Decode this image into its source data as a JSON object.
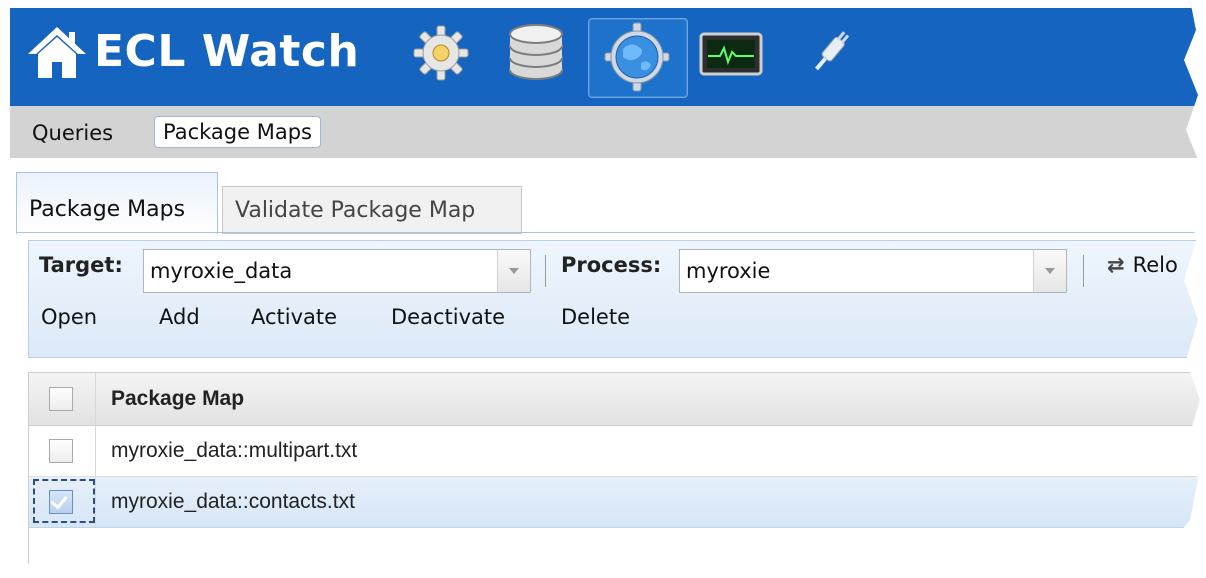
{
  "app": {
    "title": "ECL Watch",
    "icons": [
      "home-icon",
      "gear-icon",
      "database-icon",
      "topology-globe-icon",
      "monitor-icon",
      "plug-icon"
    ],
    "selected_icon": "topology-globe-icon",
    "brand_color": "#1565c0"
  },
  "subnav": {
    "items": [
      {
        "label": "Queries",
        "active": false
      },
      {
        "label": "Package Maps",
        "active": true
      }
    ]
  },
  "tabs": [
    {
      "label": "Package Maps",
      "active": true
    },
    {
      "label": "Validate Package Map",
      "active": false
    }
  ],
  "toolbar": {
    "target_label": "Target:",
    "target_value": "myroxie_data",
    "process_label": "Process:",
    "process_value": "myroxie",
    "reload_label": "Relo",
    "actions": [
      "Open",
      "Add",
      "Activate",
      "Deactivate",
      "Delete"
    ]
  },
  "grid": {
    "column_header": "Package Map",
    "rows": [
      {
        "name": "myroxie_data::multipart.txt",
        "checked": false
      },
      {
        "name": "myroxie_data::contacts.txt",
        "checked": true
      }
    ]
  }
}
